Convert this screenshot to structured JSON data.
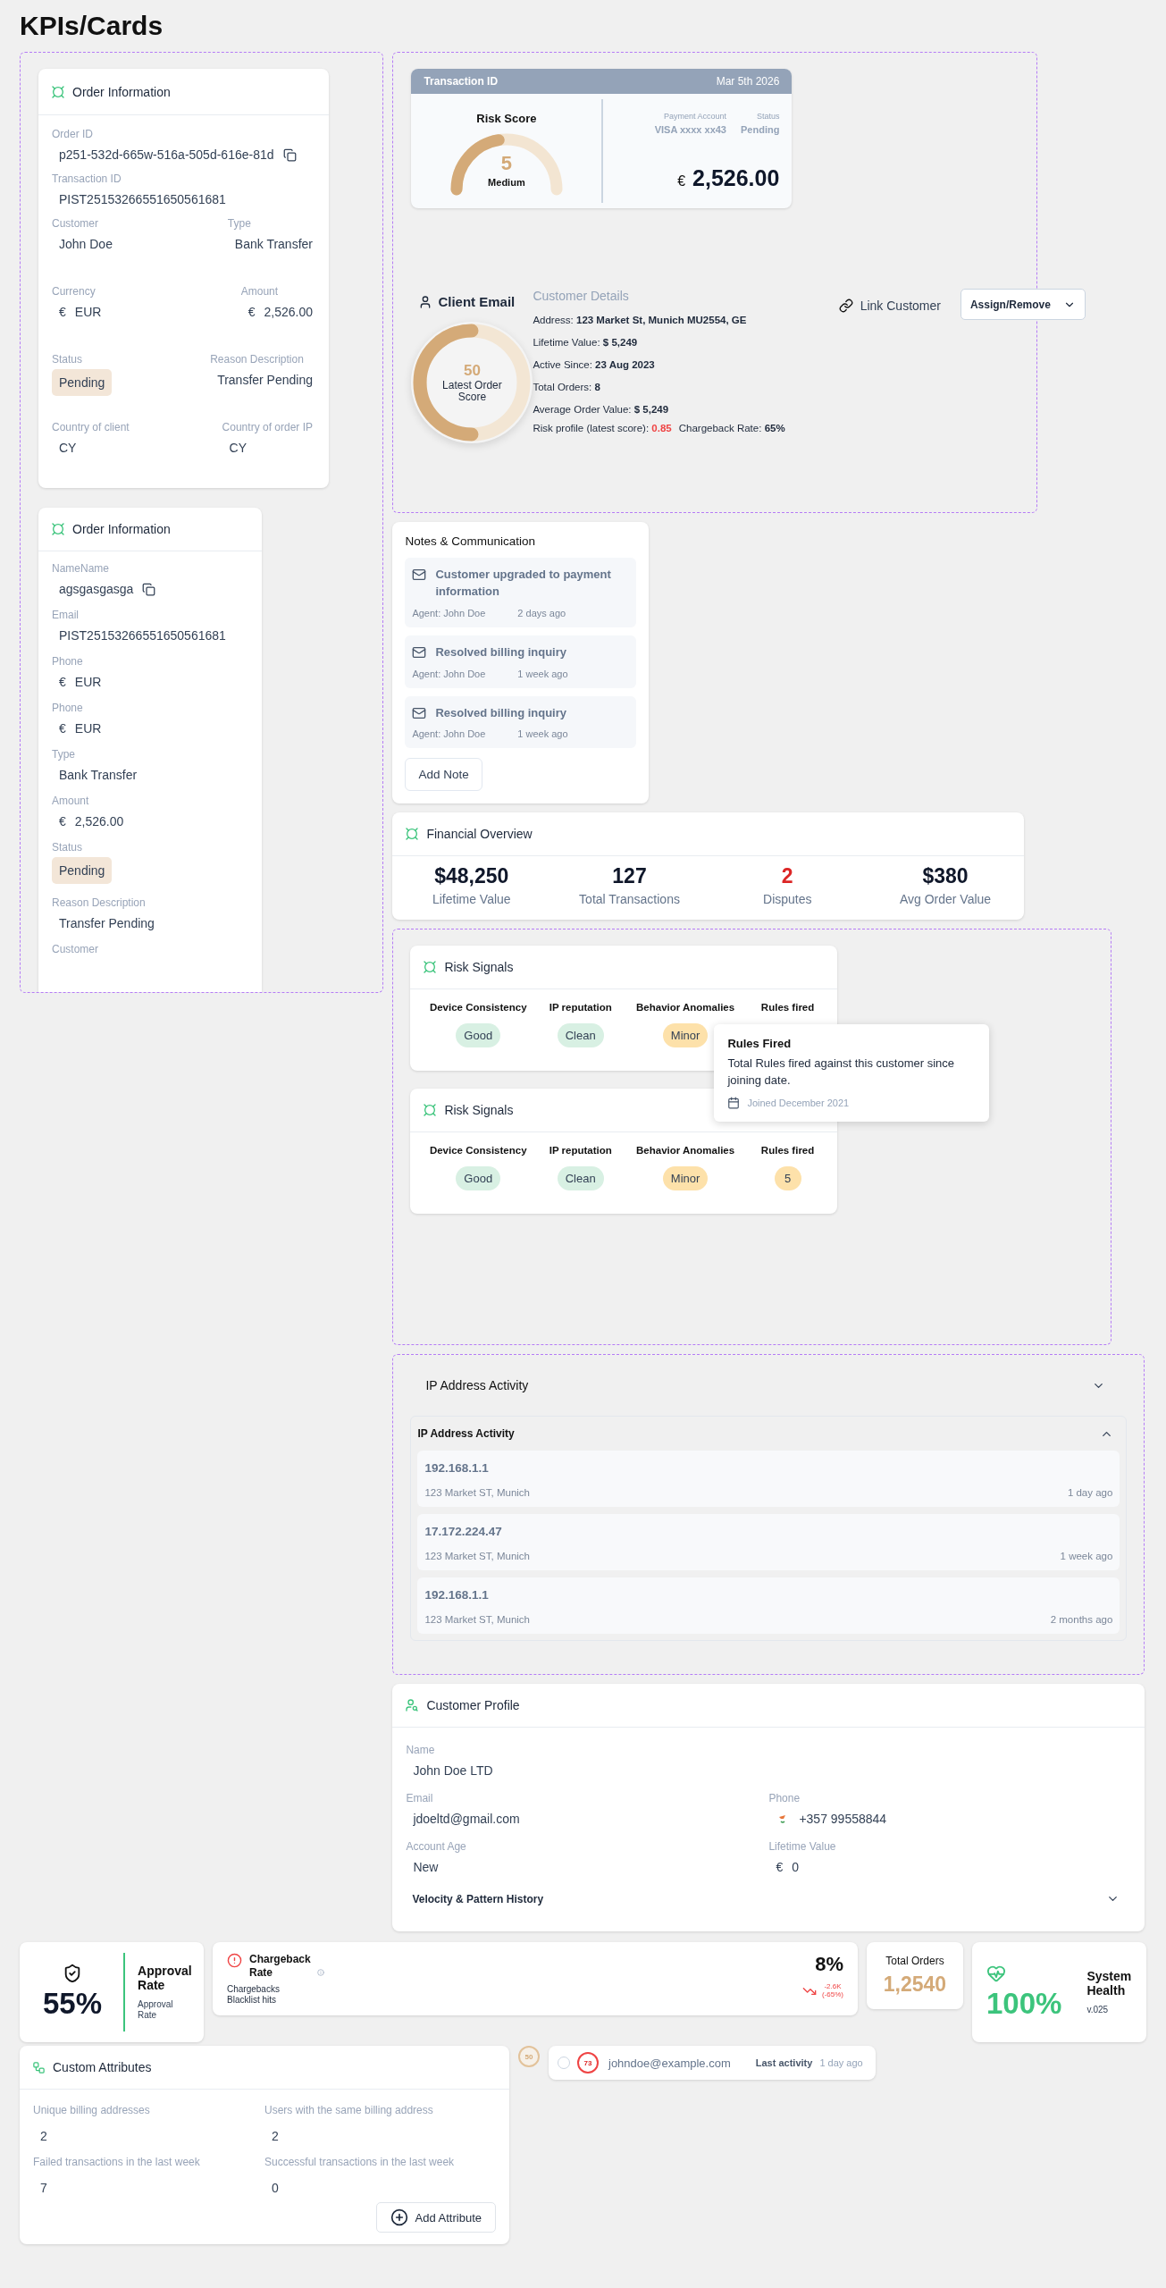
{
  "page_title": "KPIs/Cards",
  "order_card": {
    "title": "Order Information",
    "rows": [
      {
        "fields": [
          {
            "label": "Order ID",
            "value": "p251-532d-665w-516a-505d-616e-81d",
            "kind": "text",
            "copyable": true
          }
        ]
      },
      {
        "fields": [
          {
            "label": "Transaction ID",
            "value": "PIST25153266551650561681",
            "kind": "text",
            "copyable": false
          }
        ]
      },
      {
        "fields": [
          {
            "label": "Customer",
            "value": "John Doe",
            "kind": "text",
            "copyable": false
          },
          {
            "label": "Type",
            "value": "Bank Transfer",
            "kind": "text",
            "copyable": false
          }
        ]
      },
      {
        "fields": [
          {
            "label": "Currency",
            "value": "EUR",
            "symbol": "€",
            "kind": "currency",
            "copyable": false
          },
          {
            "label": "Amount",
            "value": "2,526.00",
            "symbol": "€",
            "kind": "currency",
            "copyable": false
          }
        ]
      },
      {
        "fields": [
          {
            "label": "Status",
            "value": "Pending",
            "kind": "badge",
            "copyable": false
          },
          {
            "label": "Reason Description",
            "value": "Transfer Pending",
            "kind": "text",
            "copyable": false
          }
        ]
      },
      {
        "fields": [
          {
            "label": "Country of client",
            "value": "CY",
            "kind": "text",
            "copyable": false
          },
          {
            "label": "Country of order IP",
            "value": "CY",
            "kind": "text",
            "copyable": false
          }
        ]
      }
    ]
  },
  "order_card_compact": {
    "title": "Order Information",
    "fields": [
      {
        "label": "NameName",
        "value": "agsgasgasga",
        "kind": "text",
        "copyable": true
      },
      {
        "label": "Email",
        "value": "PIST25153266551650561681",
        "kind": "text",
        "copyable": false
      },
      {
        "label": "Phone",
        "value": "EUR",
        "symbol": "€",
        "kind": "currency",
        "copyable": false
      },
      {
        "label": "Phone",
        "value": "EUR",
        "symbol": "€",
        "kind": "currency",
        "copyable": false
      },
      {
        "label": "Type",
        "value": "Bank Transfer",
        "kind": "text",
        "copyable": false
      },
      {
        "label": "Amount",
        "value": "2,526.00",
        "symbol": "€",
        "kind": "currency",
        "copyable": false
      },
      {
        "label": "Status",
        "value": "Pending",
        "kind": "badge",
        "copyable": false
      },
      {
        "label": "Reason Description",
        "value": "Transfer Pending",
        "kind": "text",
        "copyable": false
      },
      {
        "label": "Customer",
        "kind": "text"
      }
    ]
  },
  "transaction_card": {
    "header": "Transaction ID",
    "date": "Mar 5th 2026",
    "risk_title": "Risk Score",
    "risk_score": "5",
    "risk_label": "Medium",
    "level": 0.45,
    "payment_label": "Payment Account",
    "payment_value": "VISA xxxx xx43",
    "status_label": "Status",
    "status_value": "Pending",
    "currency": "€",
    "amount": "2,526.00"
  },
  "client": {
    "title": "Client Email",
    "score": "50",
    "score_label": "Latest Order Score",
    "level": 0.5,
    "details_title": "Customer Details",
    "details": [
      {
        "label": "Address:",
        "value": "123 Market St, Munich MU2554, GE"
      },
      {
        "label": "Lifetime Value:",
        "value": "$ 5,249"
      },
      {
        "label": "Active Since:",
        "value": "23 Aug 2023"
      },
      {
        "label": "Total Orders:",
        "value": "8"
      },
      {
        "label": "Average Order Value:",
        "value": "$ 5,249"
      }
    ],
    "risk_profile_label": "Risk profile (latest score):",
    "risk_profile_value": "0.85",
    "chargeback_label": "Chargeback Rate:",
    "chargeback_value": "65%",
    "link_label": "Link Customer",
    "assign_label": "Assign/Remove"
  },
  "notes": {
    "title": "Notes & Communication",
    "items": [
      {
        "title": "Customer upgraded to payment information",
        "agent": "Agent: John Doe",
        "time": "2 days ago"
      },
      {
        "title": "Resolved billing inquiry",
        "agent": "Agent: John Doe",
        "time": "1 week ago"
      },
      {
        "title": "Resolved billing inquiry",
        "agent": "Agent: John Doe",
        "time": "1 week ago"
      }
    ],
    "button": "Add Note"
  },
  "financial": {
    "title": "Financial Overview",
    "stats": [
      {
        "value": "$48,250",
        "label": "Lifetime Value",
        "alert": false
      },
      {
        "value": "127",
        "label": "Total Transactions",
        "alert": false
      },
      {
        "value": "2",
        "label": "Disputes",
        "alert": true
      },
      {
        "value": "$380",
        "label": "Avg Order Value",
        "alert": false
      }
    ]
  },
  "risk_signals": [
    {
      "title": "Risk Signals",
      "signals": [
        {
          "label": "Device Consistency",
          "value": "Good",
          "color": "#d8f0e3"
        },
        {
          "label": "IP reputation",
          "value": "Clean",
          "color": "#d8f0e3"
        },
        {
          "label": "Behavior Anomalies",
          "value": "Minor",
          "color": "#fde1aa"
        },
        {
          "label": "Rules fired"
        }
      ]
    },
    {
      "title": "Risk Signals",
      "signals": [
        {
          "label": "Device Consistency",
          "value": "Good",
          "color": "#d8f0e3"
        },
        {
          "label": "IP reputation",
          "value": "Clean",
          "color": "#d8f0e3"
        },
        {
          "label": "Behavior Anomalies",
          "value": "Minor",
          "color": "#fde1aa"
        },
        {
          "label": "Rules fired",
          "value": "5",
          "color": "#fde1aa"
        }
      ]
    }
  ],
  "tooltip": {
    "title": "Rules Fired",
    "text": "Total Rules fired against this customer since joining date.",
    "footnote": "Joined December 2021"
  },
  "ip_activity": {
    "title": "IP Address Activity",
    "expanded": false,
    "panel_title": "IP Address Activity",
    "panel_expanded": true,
    "items": [
      {
        "ip": "192.168.1.1",
        "address": "123 Market ST, Munich",
        "time": "1 day ago"
      },
      {
        "ip": "17.172.224.47",
        "address": "123 Market ST, Munich",
        "time": "1 week ago"
      },
      {
        "ip": "192.168.1.1",
        "address": "123 Market ST, Munich",
        "time": "2 months ago"
      }
    ]
  },
  "customer_profile": {
    "title": "Customer Profile",
    "rows": [
      {
        "fields": [
          {
            "label": "Name",
            "value": "John Doe LTD",
            "kind": "text"
          }
        ]
      },
      {
        "fields": [
          {
            "label": "Email",
            "value": "jdoeltd@gmail.com",
            "kind": "text"
          },
          {
            "label": "Phone",
            "value": "+357 99558844",
            "kind": "phone"
          }
        ]
      },
      {
        "fields": [
          {
            "label": "Account Age",
            "value": "New",
            "kind": "text"
          },
          {
            "label": "Lifetime Value",
            "value": "0",
            "symbol": "€",
            "kind": "currency"
          }
        ]
      }
    ],
    "section_title": "Velocity & Pattern History",
    "section_expanded": false
  },
  "approval": {
    "value": "55%",
    "title": "Approval Rate",
    "subtitle": "Approval Rate"
  },
  "chargeback": {
    "title": "Chargeback Rate",
    "lines": [
      "Chargebacks",
      "Blacklist hits"
    ],
    "value": "8%",
    "delta": "-2.6K",
    "delta_pct": "(-65%)"
  },
  "total_orders": {
    "label": "Total Orders",
    "value": "1,2540"
  },
  "system_health": {
    "value": "100%",
    "title": "System Health",
    "version": "v.025"
  },
  "custom_attributes": {
    "title": "Custom Attributes",
    "fields": [
      {
        "label": "Unique billing addresses",
        "value": "2"
      },
      {
        "label": "Users with the same billing address",
        "value": "2"
      },
      {
        "label": "Failed transactions in the last week",
        "value": "7"
      },
      {
        "label": "Successful transactions in the last week",
        "value": "0"
      }
    ],
    "button": "Add Attribute"
  },
  "score_badge": "50",
  "activity": {
    "selected": false,
    "score": "73",
    "email": "johndoe@example.com",
    "label": "Last activity",
    "time": "1 day ago"
  }
}
